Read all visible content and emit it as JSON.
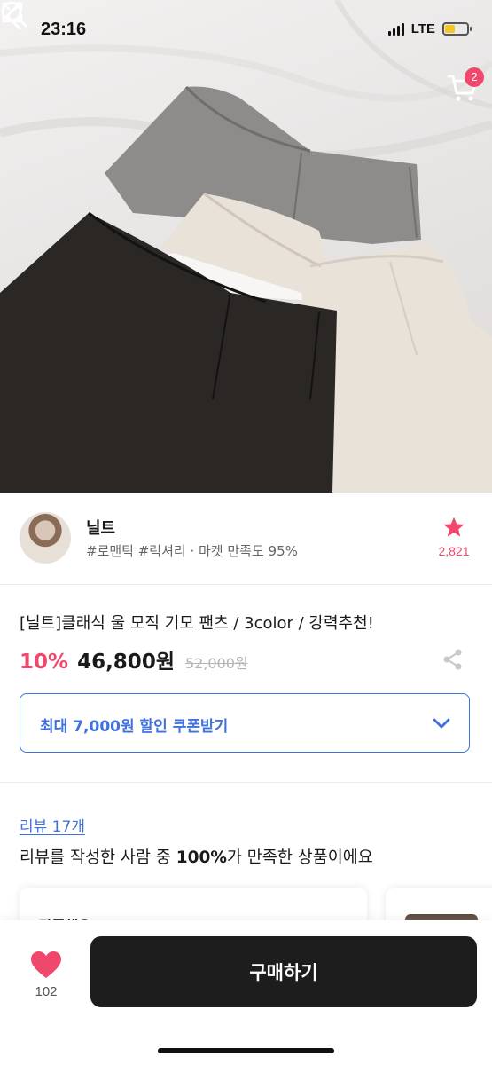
{
  "status_bar": {
    "time": "23:16",
    "network": "LTE",
    "battery_level": 0.45,
    "battery_color": "#f3c623"
  },
  "nav": {
    "back_icon": "chevron-left-icon",
    "search_icon": "search-icon",
    "cart_icon": "cart-icon",
    "cart_count": "2"
  },
  "hero": {
    "expand_icon": "expand-icon",
    "product_colors": [
      "#8c8b8b",
      "#e8e1d6",
      "#2b2826"
    ]
  },
  "seller": {
    "name": "닐트",
    "tags": "#로맨틱 #럭셔리 · 마켓 만족도 95%",
    "favorite_count": "2,821",
    "favorite_icon": "star-icon"
  },
  "product": {
    "title": "[닐트]클래식 울 모직 기모 팬츠 / 3color / 강력추천!",
    "discount": "10%",
    "price": "46,800원",
    "original_price": "52,000원",
    "share_icon": "share-icon"
  },
  "coupon": {
    "label": "최대 7,000원 할인 쿠폰받기",
    "chevron_icon": "chevron-down-icon"
  },
  "reviews": {
    "link": "리뷰 17개",
    "summary_prefix": "리뷰를 작성한 사람 중 ",
    "summary_strong": "100%",
    "summary_suffix": "가 만족한 상품이에요",
    "card_title": "만족해요"
  },
  "bottom": {
    "like_count": "102",
    "like_icon": "heart-icon",
    "buy_label": "구매하기"
  },
  "colors": {
    "accent_pink": "#f0486c",
    "accent_blue": "#3f71e0",
    "buy_button": "#1d1d1d"
  }
}
